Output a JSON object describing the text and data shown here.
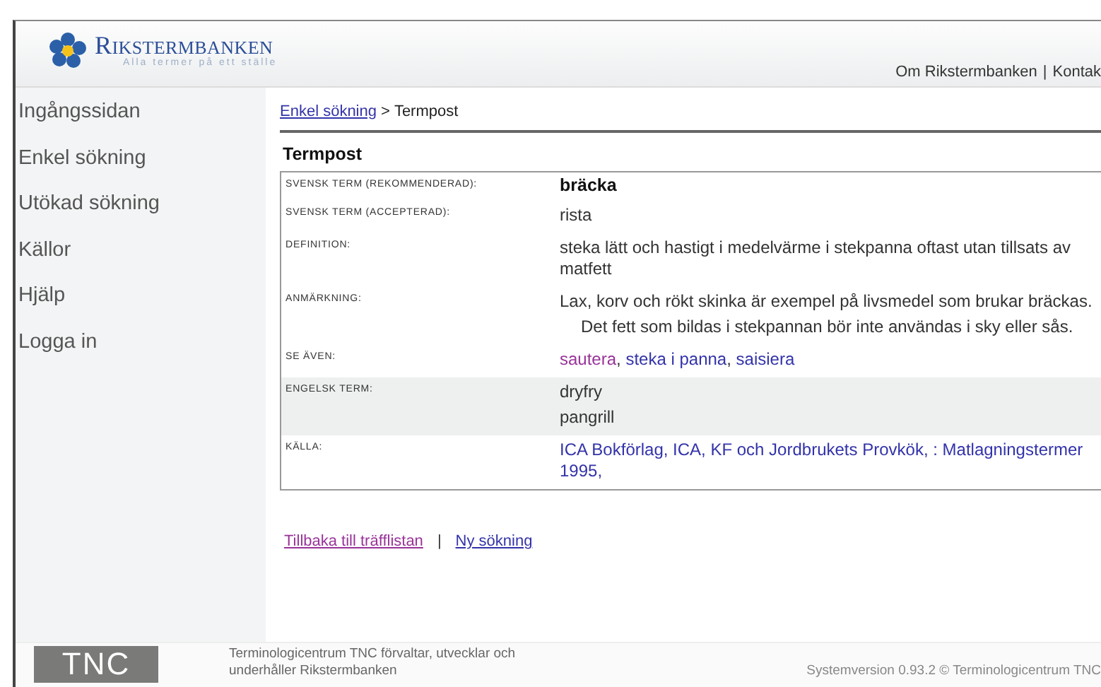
{
  "header": {
    "logo_title": "RIKSTERMBANKEN",
    "logo_tagline": "Alla termer på ett ställe",
    "top_separator": "|",
    "top_links": [
      {
        "label": "Om Rikstermbanken"
      },
      {
        "label": "Kontak"
      }
    ]
  },
  "sidebar": {
    "items": [
      {
        "label": "Ingångssidan"
      },
      {
        "label": "Enkel sökning"
      },
      {
        "label": "Utökad sökning"
      },
      {
        "label": "Källor"
      },
      {
        "label": "Hjälp"
      },
      {
        "label": "Logga in"
      }
    ]
  },
  "breadcrumb": {
    "link": "Enkel sökning",
    "separator": ">",
    "current": "Termpost"
  },
  "termpost": {
    "title": "Termpost",
    "rows": [
      {
        "label": "SVENSK TERM (REKOMMENDERAD):",
        "kind": "term",
        "shaded": false,
        "values": [
          {
            "text": "bräcka"
          }
        ]
      },
      {
        "label": "SVENSK TERM (ACCEPTERAD):",
        "kind": "text",
        "shaded": false,
        "values": [
          {
            "text": "rista"
          }
        ]
      },
      {
        "label": "DEFINITION:",
        "kind": "text",
        "shaded": false,
        "values": [
          {
            "text": "steka lätt och hastigt i medelvärme i stekpanna oftast utan tillsats av matfett"
          }
        ]
      },
      {
        "label": "ANMÄRKNING:",
        "kind": "text",
        "shaded": false,
        "values": [
          {
            "text": "Lax, korv och rökt skinka är exempel på livsmedel som brukar bräckas.",
            "indent": false
          },
          {
            "text": "Det fett som bildas i stekpannan bör inte användas i sky eller sås.",
            "indent": true
          }
        ]
      },
      {
        "label": "SE ÄVEN:",
        "kind": "links",
        "shaded": false,
        "separator": ",",
        "values": [
          {
            "text": "sautera",
            "visited": true
          },
          {
            "text": "steka i panna",
            "visited": false
          },
          {
            "text": "saisiera",
            "visited": false
          }
        ]
      },
      {
        "label": "ENGELSK TERM:",
        "kind": "text",
        "shaded": true,
        "values": [
          {
            "text": "dryfry"
          },
          {
            "text": "pangrill"
          }
        ]
      },
      {
        "label": "KÄLLA:",
        "kind": "source",
        "shaded": false,
        "values": [
          {
            "text": "ICA Bokförlag, ICA, KF och Jordbrukets Provkök, : Matlagningstermer 1995,",
            "visited": false
          }
        ]
      }
    ]
  },
  "bottom_separator": "|",
  "bottom_links": [
    {
      "label": "Tillbaka till träfflistan",
      "visited": true
    },
    {
      "label": "Ny sökning",
      "visited": false
    }
  ],
  "footer": {
    "logo_text": "TNC",
    "description": "Terminologicentrum TNC förvaltar, utvecklar och underhåller Rikstermbanken",
    "version": "Systemversion 0.93.2 © Terminologicentrum TNC"
  }
}
